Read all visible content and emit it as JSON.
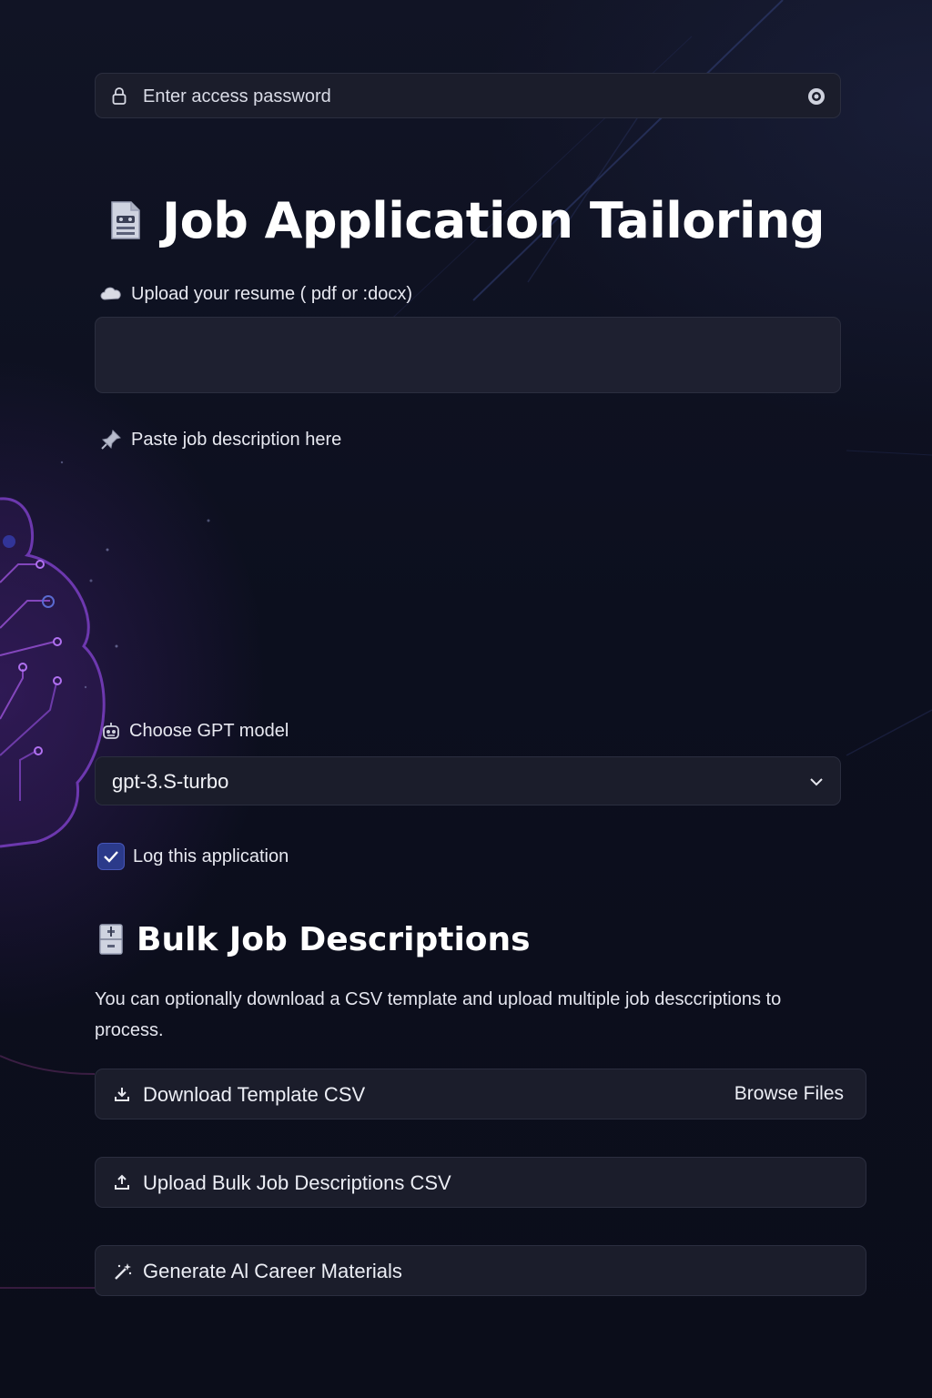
{
  "password": {
    "placeholder": "Enter access password"
  },
  "header": {
    "title": "Job Application Tailoring"
  },
  "resume": {
    "label": "Upload your resume ( pdf or :docx)"
  },
  "job_description": {
    "label": "Paste job description here"
  },
  "model": {
    "label": "Choose GPT model",
    "selected": "gpt-3.S-turbo"
  },
  "log": {
    "label": "Log this application",
    "checked": true
  },
  "bulk": {
    "title": "Bulk Job Descriptions",
    "description": "You can optionally download a CSV template and upload multiple job desccriptions to process.",
    "download_label": "Download Template CSV",
    "browse_label": "Browse Files",
    "upload_label": "Upload Bulk Job Descriptions CSV"
  },
  "generate": {
    "label": "Generate Al Career Materials"
  },
  "colors": {
    "background": "#0b0d19",
    "field": "#1b1d2b",
    "checkbox": "#2b3a8a",
    "accent_purple": "#7b3fc4"
  },
  "icons": {
    "password": "lock-icon",
    "visibility": "eye-icon",
    "title": "document-icon",
    "resume": "cloud-icon",
    "job_description": "pin-icon",
    "model": "robot-icon",
    "bulk": "file-cabinet-icon",
    "download": "download-icon",
    "upload": "upload-icon",
    "generate": "magic-wand-icon"
  }
}
